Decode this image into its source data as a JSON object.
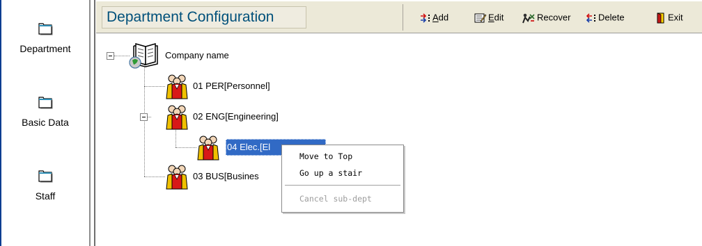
{
  "sidebar": {
    "items": [
      {
        "label": "Department",
        "icon": "folder-icon"
      },
      {
        "label": "Basic Data",
        "icon": "folder-icon"
      },
      {
        "label": "Staff",
        "icon": "folder-icon"
      }
    ]
  },
  "header": {
    "title": "Department Configuration"
  },
  "toolbar": {
    "add": {
      "label": "Add",
      "accel": "A",
      "rest": "dd"
    },
    "edit": {
      "label": "Edit",
      "accel": "E",
      "rest": "dit"
    },
    "recover": {
      "label": "Recover"
    },
    "delete": {
      "label": "Delete"
    },
    "exit": {
      "label": "Exit"
    }
  },
  "tree": {
    "root": {
      "label": "Company name"
    },
    "nodes": [
      {
        "label": "01 PER[Personnel]"
      },
      {
        "label": "02 ENG[Engineering]"
      },
      {
        "label": "04 Elec.[El"
      },
      {
        "label": "03 BUS[Busines"
      }
    ]
  },
  "context_menu": {
    "items": [
      {
        "label": "Move to Top",
        "enabled": true
      },
      {
        "label": "Go up a stair",
        "enabled": true
      },
      {
        "label": "Cancel sub-dept",
        "enabled": false
      }
    ]
  },
  "colors": {
    "title_text": "#00507a",
    "selection": "#316ac5",
    "toolbar_bg": "#ece9d8"
  }
}
